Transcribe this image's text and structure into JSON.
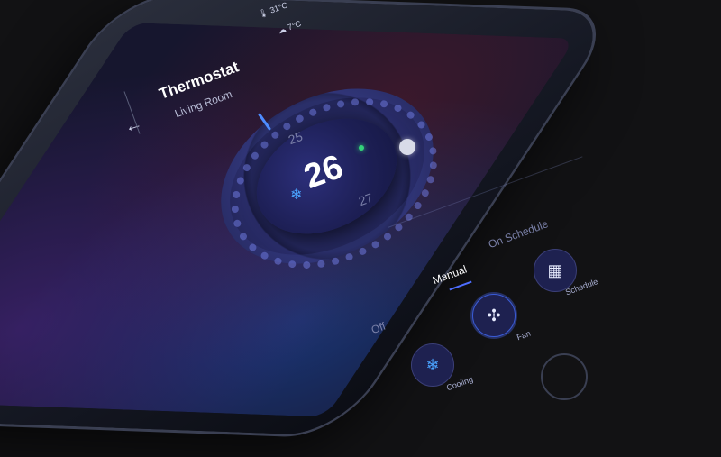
{
  "status_bar": {
    "indoor_temp": "31°C",
    "outdoor_temp": "7°C"
  },
  "header": {
    "back_icon": "arrow-left-icon",
    "title": "Thermostat",
    "subtitle": "Living Room"
  },
  "dial": {
    "current": "26",
    "above": "25",
    "below": "27",
    "mode_icon": "snowflake-icon"
  },
  "tabs": {
    "off": "Off",
    "manual": "Manual",
    "on_schedule": "On Schedule"
  },
  "controls": {
    "cooling": {
      "label": "Cooling",
      "icon": "snowflake-icon"
    },
    "fan": {
      "label": "Fan",
      "icon": "fan-icon"
    },
    "schedule": {
      "label": "Schedule",
      "icon": "calendar-icon"
    }
  },
  "colors": {
    "accent": "#4d6dff",
    "active_dot": "#34d27a",
    "cool": "#4aa3ff"
  }
}
